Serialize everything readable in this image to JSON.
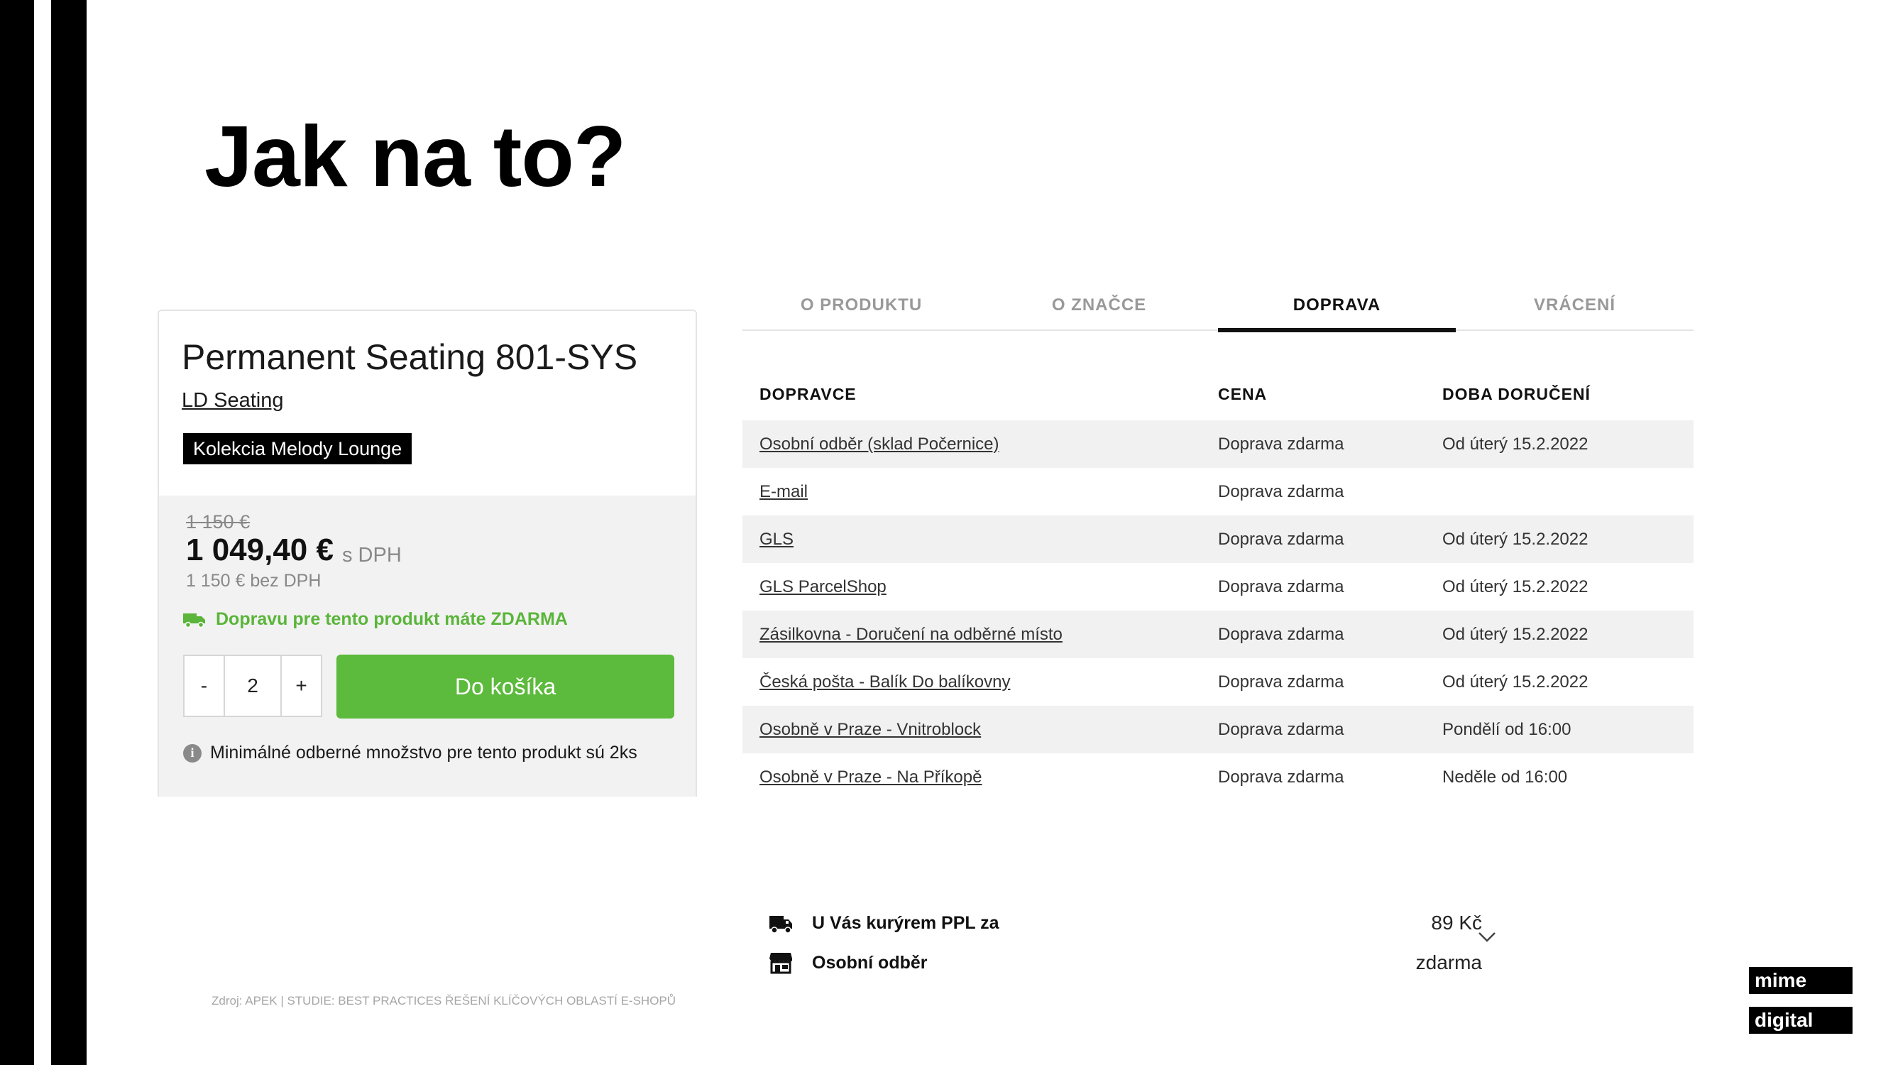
{
  "slide": {
    "title": "Jak na to?",
    "source": "Zdroj: APEK | STUDIE: BEST PRACTICES ŘEŠENÍ KLÍČOVÝCH OBLASTÍ E-SHOPŮ"
  },
  "logo": {
    "line1": "mime",
    "line2": "digital"
  },
  "product": {
    "name": "Permanent Seating 801-SYS",
    "brand": "LD Seating",
    "collection": "Kolekcia Melody Lounge",
    "old_price": "1 150 €",
    "price": "1 049,40 €",
    "price_suffix": "s DPH",
    "price_net": "1 150 € bez DPH",
    "free_shipping": "Dopravu pre tento produkt máte ZDARMA",
    "qty_minus": "-",
    "qty_value": "2",
    "qty_plus": "+",
    "add_to_cart": "Do košíka",
    "min_note": "Minimálné odberné množstvo pre tento produkt sú 2ks",
    "accent_color": "#5cba3c"
  },
  "tabs": [
    {
      "label": "O PRODUKTU"
    },
    {
      "label": "O ZNAČCE"
    },
    {
      "label": "DOPRAVA",
      "active": true
    },
    {
      "label": "VRÁCENÍ"
    }
  ],
  "shipping_table": {
    "headers": [
      "DOPRAVCE",
      "CENA",
      "DOBA DORUČENÍ"
    ],
    "rows": [
      [
        "Osobní odběr (sklad Počernice)",
        "Doprava zdarma",
        "Od úterý 15.2.2022"
      ],
      [
        "E-mail",
        "Doprava zdarma",
        ""
      ],
      [
        "GLS",
        "Doprava zdarma",
        "Od úterý 15.2.2022"
      ],
      [
        "GLS ParcelShop",
        "Doprava zdarma",
        "Od úterý 15.2.2022"
      ],
      [
        "Zásilkovna - Doručení na odběrné místo",
        "Doprava zdarma",
        "Od úterý 15.2.2022"
      ],
      [
        "Česká pošta - Balík Do balíkovny",
        "Doprava zdarma",
        "Od úterý 15.2.2022"
      ],
      [
        "Osobně v Praze - Vnitroblock",
        "Doprava zdarma",
        "Pondělí od 16:00"
      ],
      [
        "Osobně v Praze - Na Příkopě",
        "Doprava zdarma",
        "Neděle od 16:00"
      ]
    ]
  },
  "delivery_summary": {
    "rows": [
      {
        "icon": "truck-icon",
        "label": "U Vás kurýrem PPL za",
        "price": "89 Kč"
      },
      {
        "icon": "store-icon",
        "label": "Osobní odběr",
        "price": "zdarma"
      }
    ]
  }
}
